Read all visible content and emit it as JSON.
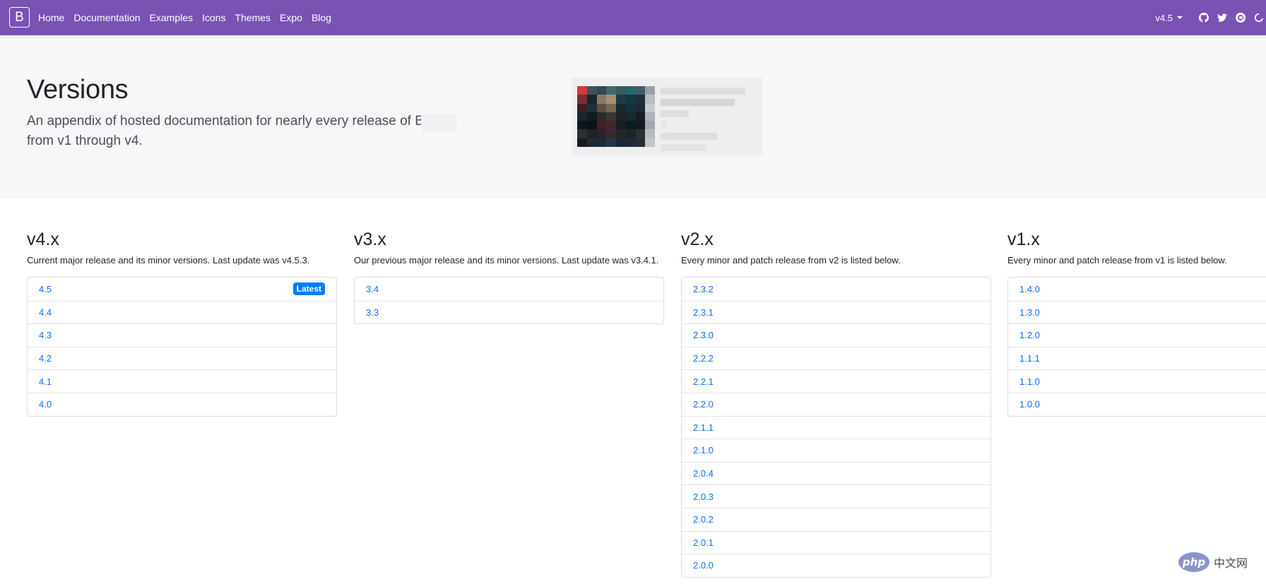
{
  "navbar": {
    "brand": "B",
    "links": [
      "Home",
      "Documentation",
      "Examples",
      "Icons",
      "Themes",
      "Expo",
      "Blog"
    ],
    "version": "v4.5",
    "icons": [
      "github-icon",
      "twitter-icon",
      "opencollective-icon",
      "slack-icon"
    ]
  },
  "hero": {
    "title": "Versions",
    "lead": "An appendix of hosted documentation for nearly every release of Boot from v1 through v4."
  },
  "columns": [
    {
      "title": "v4.x",
      "desc": "Current major release and its minor versions. Last update was v4.5.3.",
      "items": [
        "4.5",
        "4.4",
        "4.3",
        "4.2",
        "4.1",
        "4.0"
      ],
      "badge": "Latest"
    },
    {
      "title": "v3.x",
      "desc": "Our previous major release and its minor versions. Last update was v3.4.1.",
      "items": [
        "3.4",
        "3.3"
      ]
    },
    {
      "title": "v2.x",
      "desc": "Every minor and patch release from v2 is listed below.",
      "items": [
        "2.3.2",
        "2.3.1",
        "2.3.0",
        "2.2.2",
        "2.2.1",
        "2.2.0",
        "2.1.1",
        "2.1.0",
        "2.0.4",
        "2.0.3",
        "2.0.2",
        "2.0.1",
        "2.0.0"
      ]
    },
    {
      "title": "v1.x",
      "desc": "Every minor and patch release from v1 is listed below.",
      "items": [
        "1.4.0",
        "1.3.0",
        "1.2.0",
        "1.1.1",
        "1.1.0",
        "1.0.0"
      ]
    }
  ],
  "watermark": {
    "logo": "php",
    "text": "中文网"
  },
  "colors": {
    "navbar": "#7952b3",
    "link": "#0d6efd",
    "badge": "#007bff",
    "hero_bg": "#f7f7f9"
  }
}
